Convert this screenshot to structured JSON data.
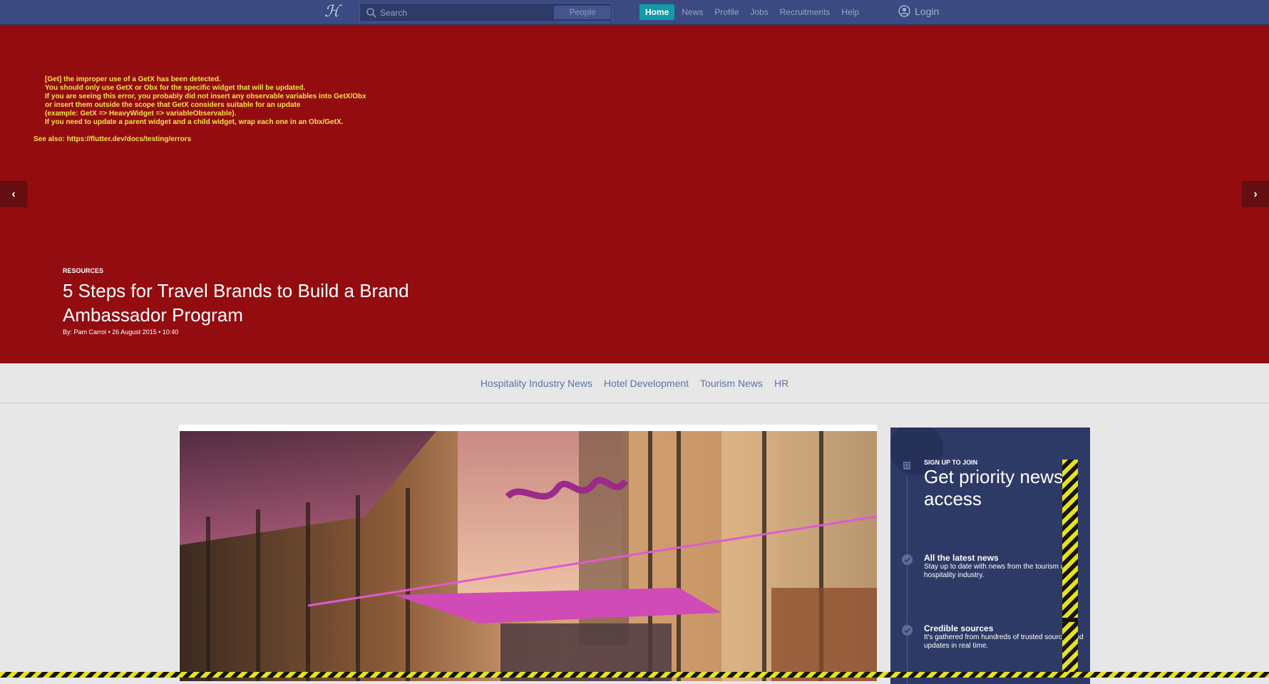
{
  "navbar": {
    "logo": "ℋ",
    "search_placeholder": "Search",
    "people_label": "People",
    "links": [
      {
        "label": "Home",
        "active": true
      },
      {
        "label": "News",
        "active": false
      },
      {
        "label": "Profile",
        "active": false
      },
      {
        "label": "Jobs",
        "active": false
      },
      {
        "label": "Recruitments",
        "active": false
      },
      {
        "label": "Help",
        "active": false
      }
    ],
    "login_label": "Login"
  },
  "hero": {
    "error_lines": "[Get] the improper use of a GetX has been detected.\nYou should only use GetX or Obx for the specific widget that will be updated.\nIf you are seeing this error, you probably did not insert any observable variables into GetX/Obx\nor insert them outside the scope that GetX considers suitable for an update\n(example: GetX => HeavyWidget => variableObservable).\nIf you need to update a parent widget and a child widget, wrap each one in an Obx/GetX.",
    "error_link": "See also: https://flutter.dev/docs/testing/errors",
    "prev_arrow": "‹",
    "next_arrow": "›",
    "category": "RESOURCES",
    "title": "5 Steps for Travel Brands to Build a Brand Ambassador Program",
    "meta": "By: Pam Carrol • 26 August 2015 • 10:40",
    "background_color": "#930c10"
  },
  "categories": [
    "Hospitality Industry News",
    "Hotel Development",
    "Tourism News",
    "HR"
  ],
  "signup": {
    "kicker": "SIGN UP TO JOIN",
    "headline": "Get priority news access",
    "features": [
      {
        "title": "All the latest news",
        "desc": "Stay up to date with news from the tourism and hospitality industry."
      },
      {
        "title": "Credible sources",
        "desc": "It's gathered from hundreds of trusted sources and updates in real time."
      }
    ]
  },
  "colors": {
    "navbar": "#3b4a80",
    "active_tab": "#139ba8",
    "error_text": "#f3e24d",
    "category_link": "#5d74a8",
    "signup_bg": "#2e3a66"
  }
}
